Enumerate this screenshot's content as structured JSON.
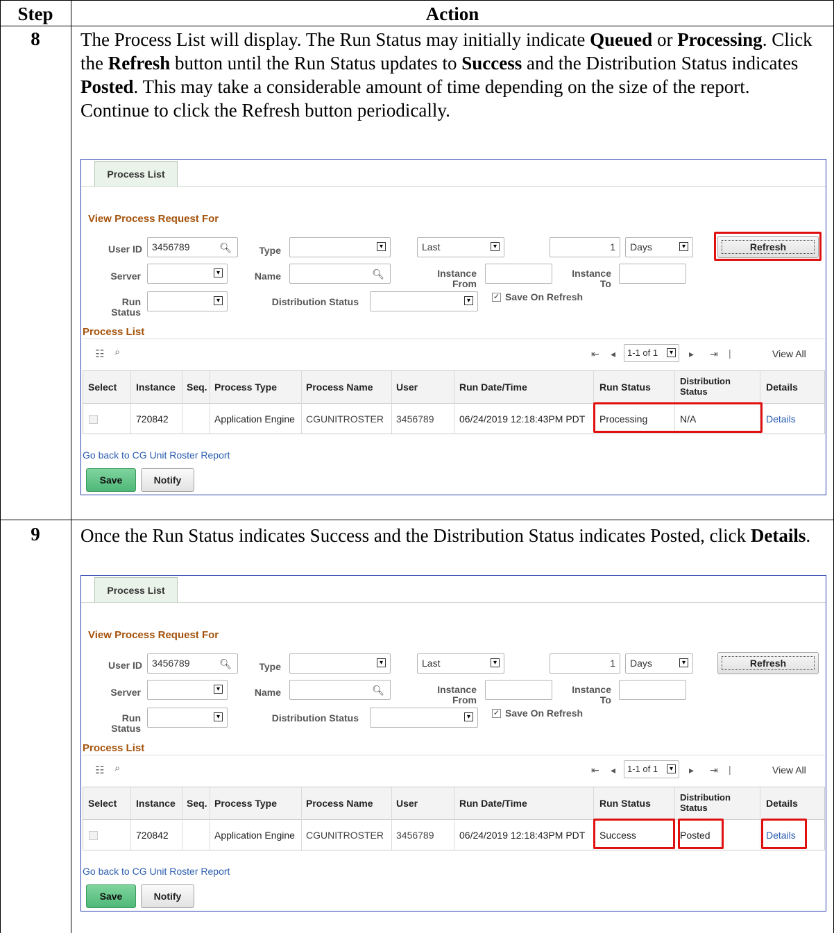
{
  "table": {
    "header_step": "Step",
    "header_action": "Action"
  },
  "steps": [
    {
      "num": "8",
      "instruction_parts": [
        {
          "t": "The Process List will display. The Run Status may initially indicate ",
          "b": false
        },
        {
          "t": "Queued",
          "b": true
        },
        {
          "t": " or ",
          "b": false
        },
        {
          "t": "Processing",
          "b": true
        },
        {
          "t": ". Click the ",
          "b": false
        },
        {
          "t": "Refresh",
          "b": true
        },
        {
          "t": " button until the Run Status updates to ",
          "b": false
        },
        {
          "t": "Success",
          "b": true
        },
        {
          "t": " and the Distribution Status indicates ",
          "b": false
        },
        {
          "t": "Posted",
          "b": true
        },
        {
          "t": ". This may take a considerable amount of time depending on the size of the report. Continue to click the Refresh button periodically.",
          "b": false
        }
      ],
      "panel": {
        "tab": "Process List",
        "section_title": "View Process Request For",
        "user_id_label": "User ID",
        "user_id_value": "3456789",
        "type_label": "Type",
        "type_value": "",
        "range_value": "Last",
        "range_count": "1",
        "range_unit": "Days",
        "refresh_label": "Refresh",
        "server_label": "Server",
        "name_label": "Name",
        "instance_from_label_1": "Instance",
        "instance_from_label_2": "From",
        "instance_to_label_1": "Instance",
        "instance_to_label_2": "To",
        "run_status_label_1": "Run",
        "run_status_label_2": "Status",
        "dist_status_label": "Distribution Status",
        "save_on_refresh_label": "Save On Refresh",
        "grid_title": "Process List",
        "pager_text": "1-1 of 1",
        "view_all": "View All",
        "headers": {
          "select": "Select",
          "instance": "Instance",
          "seq": "Seq.",
          "ptype": "Process Type",
          "pname": "Process Name",
          "user": "User",
          "rundt": "Run Date/Time",
          "runstatus": "Run Status",
          "dist1": "Distribution",
          "dist2": "Status",
          "details": "Details"
        },
        "row": {
          "instance": "720842",
          "seq": "",
          "ptype": "Application Engine",
          "pname": "CGUNITROSTER",
          "user": "3456789",
          "rundt": "06/24/2019 12:18:43PM PDT",
          "runstatus": "Processing",
          "dist": "N/A",
          "details": "Details"
        },
        "go_back_link": "Go back to CG Unit Roster Report",
        "save_button": "Save",
        "notify_button": "Notify"
      }
    },
    {
      "num": "9",
      "instruction_parts": [
        {
          "t": "Once the Run Status indicates Success and the Distribution Status indicates Posted, click ",
          "b": false
        },
        {
          "t": "Details",
          "b": true
        },
        {
          "t": ".",
          "b": false
        }
      ],
      "panel": {
        "tab": "Process List",
        "section_title": "View Process Request For",
        "user_id_label": "User ID",
        "user_id_value": "3456789",
        "type_label": "Type",
        "type_value": "",
        "range_value": "Last",
        "range_count": "1",
        "range_unit": "Days",
        "refresh_label": "Refresh",
        "server_label": "Server",
        "name_label": "Name",
        "instance_from_label_1": "Instance",
        "instance_from_label_2": "From",
        "instance_to_label_1": "Instance",
        "instance_to_label_2": "To",
        "run_status_label_1": "Run",
        "run_status_label_2": "Status",
        "dist_status_label": "Distribution Status",
        "save_on_refresh_label": "Save On Refresh",
        "grid_title": "Process List",
        "pager_text": "1-1 of 1",
        "view_all": "View All",
        "headers": {
          "select": "Select",
          "instance": "Instance",
          "seq": "Seq.",
          "ptype": "Process Type",
          "pname": "Process Name",
          "user": "User",
          "rundt": "Run Date/Time",
          "runstatus": "Run Status",
          "dist1": "Distribution",
          "dist2": "Status",
          "details": "Details"
        },
        "row": {
          "instance": "720842",
          "seq": "",
          "ptype": "Application Engine",
          "pname": "CGUNITROSTER",
          "user": "3456789",
          "rundt": "06/24/2019 12:18:43PM PDT",
          "runstatus": "Success",
          "dist": "Posted",
          "details": "Details"
        },
        "go_back_link": "Go back to CG Unit Roster Report",
        "save_button": "Save",
        "notify_button": "Notify"
      }
    }
  ]
}
